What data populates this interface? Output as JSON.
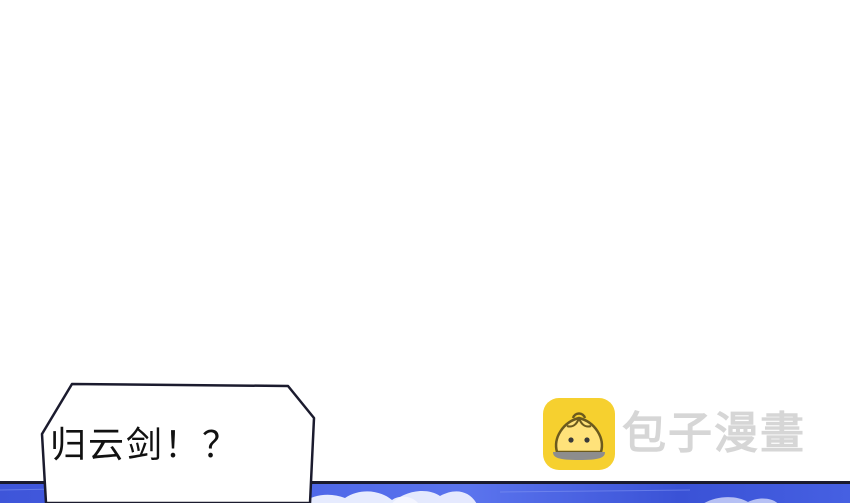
{
  "panel": {
    "dialogue": "归云剑！？"
  },
  "watermark": {
    "text": "包子漫畫",
    "logo_icon": "steamed-bun-icon",
    "logo_color": "#f6d02f"
  },
  "colors": {
    "background": "#ffffff",
    "sky": "#4a63e6",
    "outline": "#1b1b2e"
  }
}
